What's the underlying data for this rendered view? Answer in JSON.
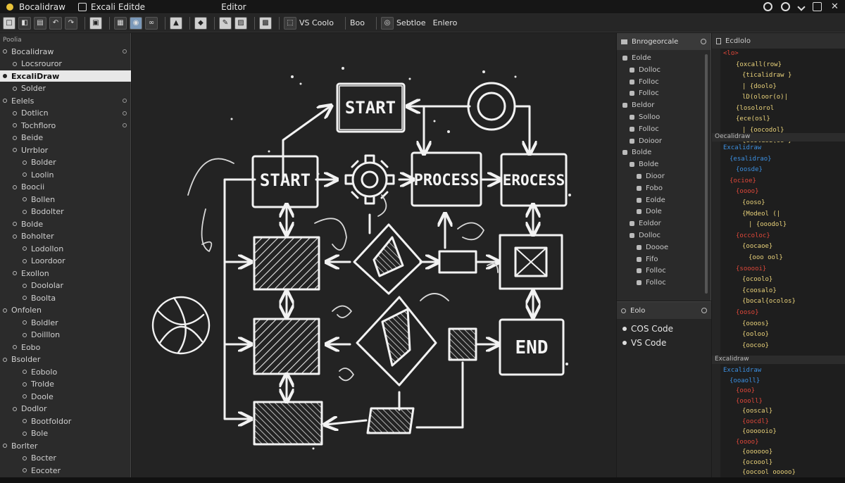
{
  "titlebar": {
    "app_name": "Bocalidraw",
    "file_name": "Excali Editde",
    "menu_editor": "Editor",
    "colors": {
      "app_dot": "#e8c23a"
    }
  },
  "toolbar": {
    "vs_code_label": "VS Coolo",
    "boo_label": "Boo",
    "section_label": "Sebtloe",
    "editor_label": "Enlero"
  },
  "sidebar": {
    "header": "Poolia",
    "items": [
      {
        "label": "Bocalidraw",
        "indent": 0
      },
      {
        "label": "Locsrouror",
        "indent": 1
      },
      {
        "label": "ExcaliDraw",
        "indent": 0,
        "active": true
      },
      {
        "label": "Solder",
        "indent": 1
      },
      {
        "label": "Eelels",
        "indent": 0
      },
      {
        "label": "Dotlicn",
        "indent": 1
      },
      {
        "label": "Tochfloro",
        "indent": 1
      },
      {
        "label": "Beide",
        "indent": 1
      },
      {
        "label": "Urrblor",
        "indent": 1
      },
      {
        "label": "Bolder",
        "indent": 2
      },
      {
        "label": "Loolin",
        "indent": 2
      },
      {
        "label": "Boocii",
        "indent": 1
      },
      {
        "label": "Bollen",
        "indent": 2
      },
      {
        "label": "Bodolter",
        "indent": 2
      },
      {
        "label": "Bolde",
        "indent": 1
      },
      {
        "label": "Boholter",
        "indent": 1
      },
      {
        "label": "Lodollon",
        "indent": 2
      },
      {
        "label": "Loordoor",
        "indent": 2
      },
      {
        "label": "Exollon",
        "indent": 1
      },
      {
        "label": "Doololar",
        "indent": 2
      },
      {
        "label": "Boolta",
        "indent": 2
      },
      {
        "label": "Onfolen",
        "indent": 0
      },
      {
        "label": "Boldler",
        "indent": 2
      },
      {
        "label": "Doilllon",
        "indent": 2
      },
      {
        "label": "Eobo",
        "indent": 1
      },
      {
        "label": "Bsolder",
        "indent": 0
      },
      {
        "label": "Eobolo",
        "indent": 2
      },
      {
        "label": "Trolde",
        "indent": 2
      },
      {
        "label": "Doole",
        "indent": 2
      },
      {
        "label": "Dodlor",
        "indent": 1
      },
      {
        "label": "Bootfoldor",
        "indent": 2
      },
      {
        "label": "Bole",
        "indent": 2
      },
      {
        "label": "Borlter",
        "indent": 0
      },
      {
        "label": "Bocter",
        "indent": 2
      },
      {
        "label": "Eocoter",
        "indent": 2
      }
    ]
  },
  "canvas": {
    "nodes": {
      "start_top": "START",
      "start_mid": "START",
      "process": "PROCESS",
      "eprocess": "EROCESS",
      "end": "END"
    },
    "colors": {
      "stroke": "#f2f2f2",
      "background": "#232323"
    }
  },
  "explorer": {
    "header": "Bnrogeorcale",
    "items": [
      {
        "label": "Eolde",
        "indent": 0
      },
      {
        "label": "Dolloc",
        "indent": 1
      },
      {
        "label": "Folloc",
        "indent": 1
      },
      {
        "label": "Folloc",
        "indent": 1
      },
      {
        "label": "Beldor",
        "indent": 0
      },
      {
        "label": "Solloo",
        "indent": 1
      },
      {
        "label": "Folloc",
        "indent": 1
      },
      {
        "label": "Doioor",
        "indent": 1
      },
      {
        "label": "Bolde",
        "indent": 0
      },
      {
        "label": "Bolde",
        "indent": 1
      },
      {
        "label": "Dioor",
        "indent": 2
      },
      {
        "label": "Fobo",
        "indent": 2
      },
      {
        "label": "Eolde",
        "indent": 2
      },
      {
        "label": "Dole",
        "indent": 2
      },
      {
        "label": "Eoldor",
        "indent": 1
      },
      {
        "label": "Dolloc",
        "indent": 1
      },
      {
        "label": "Doooe",
        "indent": 2
      },
      {
        "label": "Fifo",
        "indent": 2
      },
      {
        "label": "Folloc",
        "indent": 2
      },
      {
        "label": "Folloc",
        "indent": 2
      }
    ]
  },
  "outline": {
    "header": "Eolo",
    "items": [
      {
        "label": "COS Code"
      },
      {
        "label": "VS Code"
      }
    ]
  },
  "code_panel": {
    "header": "Ecdlolo",
    "divider1": "Oecalidraw",
    "divider2": "Excalidraw",
    "colors": {
      "keyword": "#e0483a",
      "text": "#e9d27a",
      "blue": "#3c8fe0",
      "green": "#7ec46a"
    },
    "lines": [
      {
        "text": "<lo>",
        "color": "keyword",
        "indent": 0
      },
      {
        "text": "{oxcall(row}",
        "color": "text",
        "indent": 2
      },
      {
        "text": "{ticalidraw }",
        "color": "text",
        "indent": 3
      },
      {
        "text": "| {doolo}",
        "color": "text",
        "indent": 3
      },
      {
        "text": "lD(oloor(o)|",
        "color": "text",
        "indent": 3
      },
      {
        "text": "{losolorol",
        "color": "text",
        "indent": 2
      },
      {
        "text": "{ece(osl}",
        "color": "text",
        "indent": 2
      },
      {
        "text": "| {oocodol}",
        "color": "text",
        "indent": 3
      },
      {
        "text": "{ecoldsi(os }",
        "color": "text",
        "indent": 3
      },
      {
        "text": "Excalidraw",
        "color": "blue",
        "indent": 0
      },
      {
        "text": "{esalidrao}",
        "color": "blue",
        "indent": 1
      },
      {
        "text": "{oosde}",
        "color": "blue",
        "indent": 2
      },
      {
        "text": "{ocioe}",
        "color": "keyword",
        "indent": 1
      },
      {
        "text": "{oooo}",
        "color": "keyword",
        "indent": 2
      },
      {
        "text": "{ooso}",
        "color": "text",
        "indent": 3
      },
      {
        "text": "{Modeol (|",
        "color": "text",
        "indent": 3
      },
      {
        "text": "| {ooodol}",
        "color": "text",
        "indent": 4
      },
      {
        "text": "{occoloc}",
        "color": "keyword",
        "indent": 2
      },
      {
        "text": "{oocaoe}",
        "color": "text",
        "indent": 3
      },
      {
        "text": "{ooo ool}",
        "color": "text",
        "indent": 4
      },
      {
        "text": "{sooooi}",
        "color": "keyword",
        "indent": 2
      },
      {
        "text": "{ocoolo}",
        "color": "text",
        "indent": 3
      },
      {
        "text": "{coosalo}",
        "color": "text",
        "indent": 3
      },
      {
        "text": "{bocal{ocolos}",
        "color": "text",
        "indent": 3
      },
      {
        "text": "{ooso}",
        "color": "keyword",
        "indent": 2
      },
      {
        "text": "{oooos}",
        "color": "text",
        "indent": 3
      },
      {
        "text": "{ooloo}",
        "color": "text",
        "indent": 3
      },
      {
        "text": "{oocoo}",
        "color": "text",
        "indent": 3
      }
    ],
    "lines2": [
      {
        "text": "Excalidraw",
        "color": "blue",
        "indent": 0
      },
      {
        "text": "{ooaoll}",
        "color": "blue",
        "indent": 1
      },
      {
        "text": "{ooo}",
        "color": "keyword",
        "indent": 2
      },
      {
        "text": "{oooll}",
        "color": "keyword",
        "indent": 2
      },
      {
        "text": "{ooscal}",
        "color": "text",
        "indent": 3
      },
      {
        "text": "{oocdl}",
        "color": "keyword",
        "indent": 3
      },
      {
        "text": "{oooooio}",
        "color": "text",
        "indent": 3
      },
      {
        "text": "{oooo}",
        "color": "keyword",
        "indent": 2
      },
      {
        "text": "{oooooo}",
        "color": "text",
        "indent": 3
      },
      {
        "text": "{ocoool}",
        "color": "text",
        "indent": 3
      },
      {
        "text": "{oocool ooooo}",
        "color": "text",
        "indent": 3
      }
    ]
  }
}
